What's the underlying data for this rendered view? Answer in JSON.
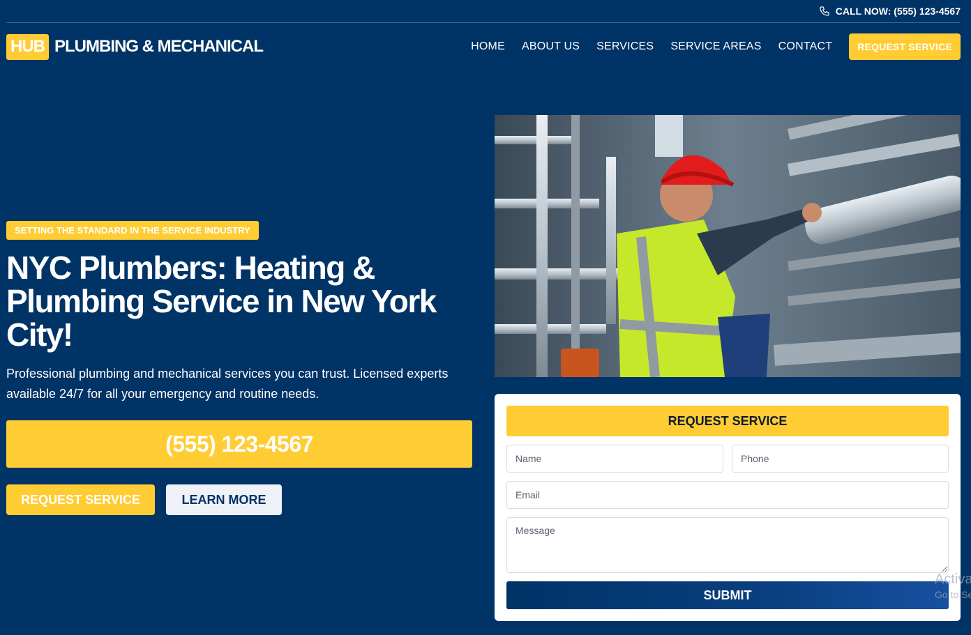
{
  "topbar": {
    "call_text": "CALL NOW: (555) 123-4567"
  },
  "header": {
    "logo_badge": "HUB",
    "logo_text": "PLUMBING & MECHANICAL",
    "nav": [
      {
        "label": "HOME"
      },
      {
        "label": "ABOUT US"
      },
      {
        "label": "SERVICES"
      },
      {
        "label": "SERVICE AREAS"
      },
      {
        "label": "CONTACT"
      }
    ],
    "cta_label": "REQUEST SERVICE"
  },
  "hero": {
    "tagline": "SETTING THE STANDARD IN THE SERVICE INDUSTRY",
    "title": "NYC Plumbers: Heating & Plumbing Service in New York City!",
    "subtitle": "Professional plumbing and mechanical services you can trust. Licensed experts available 24/7 for all your emergency and routine needs.",
    "phone": "(555) 123-4567",
    "request_label": "REQUEST SERVICE",
    "learn_label": "LEARN MORE"
  },
  "form": {
    "title": "REQUEST SERVICE",
    "name_placeholder": "Name",
    "phone_placeholder": "Phone",
    "email_placeholder": "Email",
    "message_placeholder": "Message",
    "submit_label": "SUBMIT"
  },
  "watermark": {
    "line1": "Activa",
    "line2": "Go to Se"
  },
  "colors": {
    "primary": "#003366",
    "accent": "#FFCC33",
    "white": "#ffffff"
  }
}
